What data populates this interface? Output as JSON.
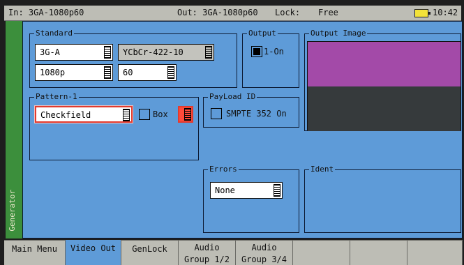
{
  "status": {
    "input": "In: 3GA-1080p60",
    "output": "Out: 3GA-1080p60",
    "lock_label": "Lock:",
    "lock_value": "Free",
    "time": "10:42",
    "battery_icon": "battery-icon"
  },
  "side_tab": {
    "label": "Generator"
  },
  "standard": {
    "title": "Standard",
    "interface": "3G-A",
    "colour_space": "YCbCr-422-10",
    "format": "1080p",
    "rate": "60"
  },
  "output": {
    "title": "Output",
    "option": "1-On",
    "checked": true
  },
  "output_image": {
    "title": "Output Image",
    "colors": [
      "#a34aa8",
      "#363a3c",
      "#5e9bd8"
    ]
  },
  "pattern": {
    "title": "Pattern-1",
    "value": "Checkfield",
    "box_label": "Box",
    "box_checked": false,
    "box_color": "#ff4a3a"
  },
  "payload": {
    "title": "PayLoad ID",
    "option": "SMPTE 352 On",
    "checked": false
  },
  "errors": {
    "title": "Errors",
    "value": "None"
  },
  "ident": {
    "title": "Ident"
  },
  "menu": [
    {
      "label": "Main Menu",
      "label2": "",
      "active": false
    },
    {
      "label": "Video Out",
      "label2": "",
      "active": true
    },
    {
      "label": "GenLock",
      "label2": "",
      "active": false
    },
    {
      "label": "Audio",
      "label2": "Group 1/2",
      "active": false
    },
    {
      "label": "Audio",
      "label2": "Group 3/4",
      "active": false
    },
    {
      "label": "",
      "label2": "",
      "active": false
    },
    {
      "label": "",
      "label2": "",
      "active": false
    },
    {
      "label": "",
      "label2": "",
      "active": false
    }
  ]
}
